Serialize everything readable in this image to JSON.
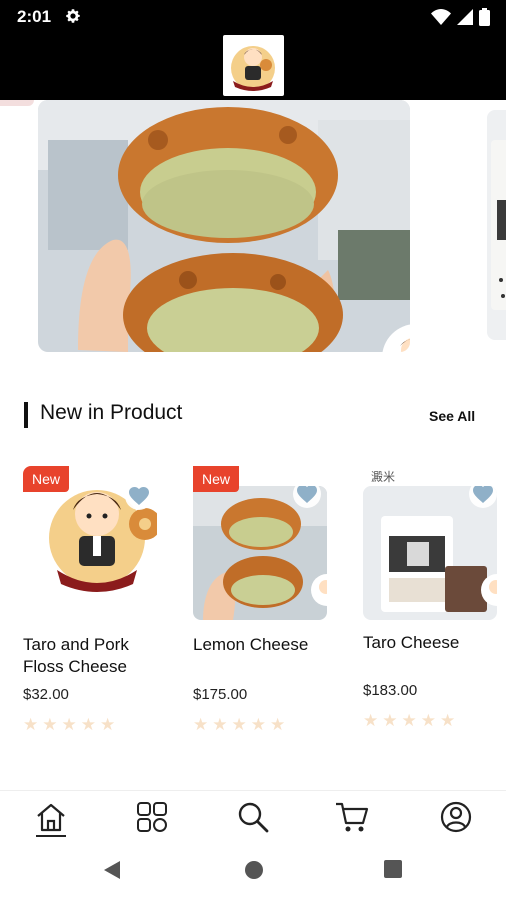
{
  "status_bar": {
    "time": "2:01"
  },
  "section": {
    "title": "New in Product",
    "see_all_label": "See All"
  },
  "products": [
    {
      "badge": "New",
      "name": "Taro and Pork Floss Cheese",
      "price": "$32.00",
      "rating": 0
    },
    {
      "badge": "New",
      "name": "Lemon Cheese",
      "price": "$175.00",
      "rating": 0
    },
    {
      "badge": "",
      "name": "Taro Cheese",
      "price": "$183.00",
      "rating": 0,
      "image_label": "澱米"
    }
  ],
  "icons": {
    "status": [
      "gear-icon",
      "wifi-icon",
      "signal-icon",
      "battery-icon"
    ],
    "nav": [
      "home-icon",
      "categories-icon",
      "search-icon",
      "cart-icon",
      "profile-icon"
    ],
    "system": [
      "back-icon",
      "home-circle-icon",
      "recents-icon"
    ]
  },
  "colors": {
    "badge": "#e8432c",
    "heart": "#8fb0c8",
    "star_empty": "#f7e1c8",
    "header_bg": "#000000"
  }
}
